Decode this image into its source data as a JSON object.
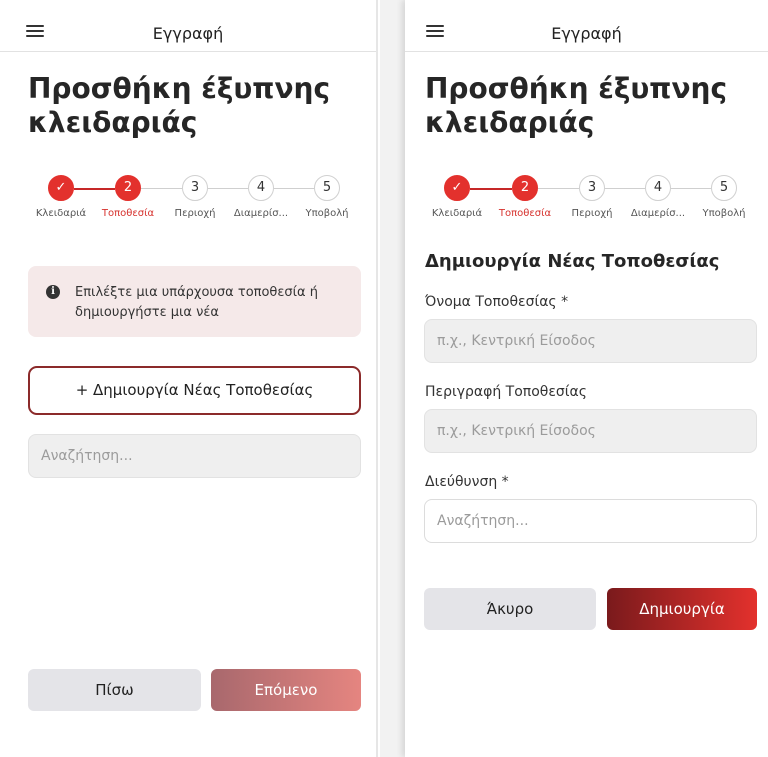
{
  "header": {
    "title": "Εγγραφή"
  },
  "page_title": "Προσθήκη έξυπνης κλειδαριάς",
  "stepper": {
    "steps": [
      {
        "number": "✓",
        "label": "Κλειδαριά"
      },
      {
        "number": "2",
        "label": "Τοποθεσία"
      },
      {
        "number": "3",
        "label": "Περιοχή"
      },
      {
        "number": "4",
        "label": "Διαμερίσ..."
      },
      {
        "number": "5",
        "label": "Υποβολή"
      }
    ]
  },
  "left": {
    "info_text": "Επιλέξτε μια υπάρχουσα τοποθεσία ή δημιουργήστε μια νέα",
    "create_location_label": "+ Δημιουργία Νέας Τοποθεσίας",
    "search_placeholder": "Αναζήτηση...",
    "back_label": "Πίσω",
    "next_label": "Επόμενο"
  },
  "right": {
    "section_title": "Δημιουργία Νέας Τοποθεσίας",
    "name_label": "Όνομα Τοποθεσίας *",
    "name_placeholder": "π.χ., Κεντρική Είσοδος",
    "description_label": "Περιγραφή Τοποθεσίας",
    "description_placeholder": "π.χ., Κεντρική Είσοδος",
    "address_label": "Διεύθυνση *",
    "address_placeholder": "Αναζήτηση...",
    "cancel_label": "Άκυρο",
    "create_label": "Δημιουργία"
  },
  "colors": {
    "accent": "#e3312d",
    "accent_dark": "#7a1a1c",
    "info_background": "#f5e9e9"
  }
}
